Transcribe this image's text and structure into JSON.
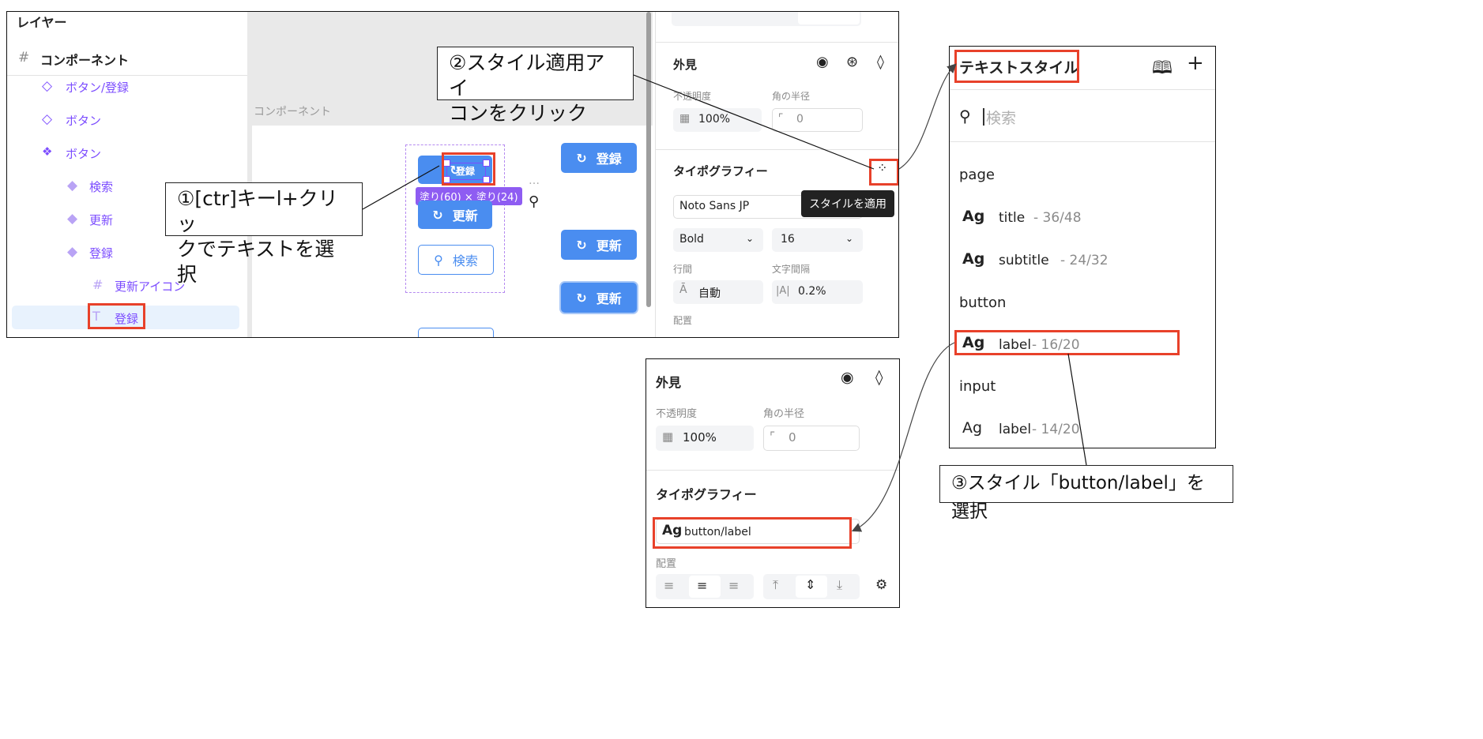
{
  "layers": {
    "title": "レイヤー",
    "component": "コンポーネント",
    "items": [
      {
        "label": "ボタン/登録"
      },
      {
        "label": "ボタン"
      },
      {
        "label": "ボタン"
      },
      {
        "label": "検索"
      },
      {
        "label": "更新"
      },
      {
        "label": "登録"
      },
      {
        "label": "更新アイコン"
      },
      {
        "label": "登録"
      }
    ]
  },
  "canvas": {
    "frame_label": "コンポーネント",
    "selected_text": "登録",
    "fill_badge": "塗り(60) × 塗り(24)",
    "dots": "…",
    "buttons": {
      "register": "登録",
      "update": "更新",
      "search": "検索"
    }
  },
  "props": {
    "appearance": "外見",
    "opacity_label": "不透明度",
    "radius_label": "角の半径",
    "opacity_value": "100%",
    "radius_value": "0",
    "typography": "タイポグラフィー",
    "font_family": "Noto Sans JP",
    "font_weight": "Bold",
    "font_size": "16",
    "line_height_label": "行間",
    "letter_spacing_label": "文字間隔",
    "line_height_value": "自動",
    "letter_spacing_value": "0.2%",
    "align_label": "配置",
    "tooltip": "スタイルを適用"
  },
  "text_styles": {
    "title": "テキストスタイル",
    "search_placeholder": "検索",
    "groups": [
      {
        "name": "page",
        "items": [
          {
            "ag": "Ag",
            "name": "title",
            "size": " - 36/48"
          },
          {
            "ag": "Ag",
            "name": "subtitle",
            "size": " - 24/32"
          }
        ]
      },
      {
        "name": "button",
        "items": [
          {
            "ag": "Ag",
            "name": "label",
            "size": " - 16/20"
          }
        ]
      },
      {
        "name": "input",
        "items": [
          {
            "ag": "Ag",
            "name": "label",
            "size": " - 14/20"
          }
        ]
      }
    ]
  },
  "result": {
    "appearance": "外見",
    "opacity_label": "不透明度",
    "radius_label": "角の半径",
    "opacity_value": "100%",
    "radius_value": "0",
    "typography": "タイポグラフィー",
    "style_ag": "Ag",
    "style_name": "button/label",
    "align_label": "配置"
  },
  "callouts": {
    "step1": "①[ctr]キーl+クリックでテキストを選択",
    "step1_line1": "①[ctr]キーl+クリッ",
    "step1_line2": "クでテキストを選択",
    "step2_line1": "②スタイル適用アイ",
    "step2_line2": "コンをクリック",
    "step3": "③スタイル「button/label」を選択"
  },
  "colors": {
    "accent_purple": "#7c4dff",
    "button_blue": "#4a8df0",
    "highlight_red": "#e8412a",
    "selection_bg": "#e8f2fd"
  }
}
